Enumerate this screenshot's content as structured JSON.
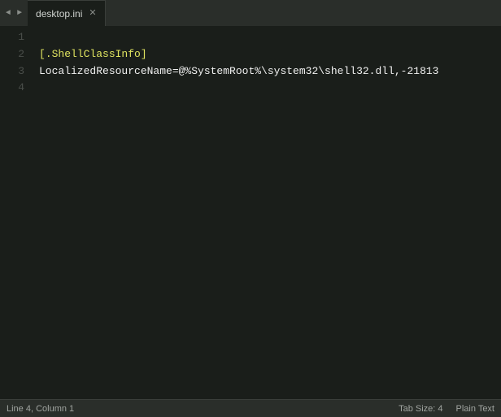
{
  "tabbar": {
    "nav_left": "◄",
    "nav_right": "►",
    "tab_name": "desktop.ini",
    "tab_close": "✕"
  },
  "editor": {
    "lines": [
      {
        "number": "1",
        "content": ""
      },
      {
        "number": "2",
        "content": "[.ShellClassInfo]"
      },
      {
        "number": "3",
        "content": "LocalizedResourceName=@%SystemRoot%\\system32\\shell32.dll,-21813"
      },
      {
        "number": "4",
        "content": ""
      }
    ]
  },
  "statusbar": {
    "position": "Line 4, Column 1",
    "tab_size": "Tab Size: 4",
    "language": "Plain Text"
  }
}
